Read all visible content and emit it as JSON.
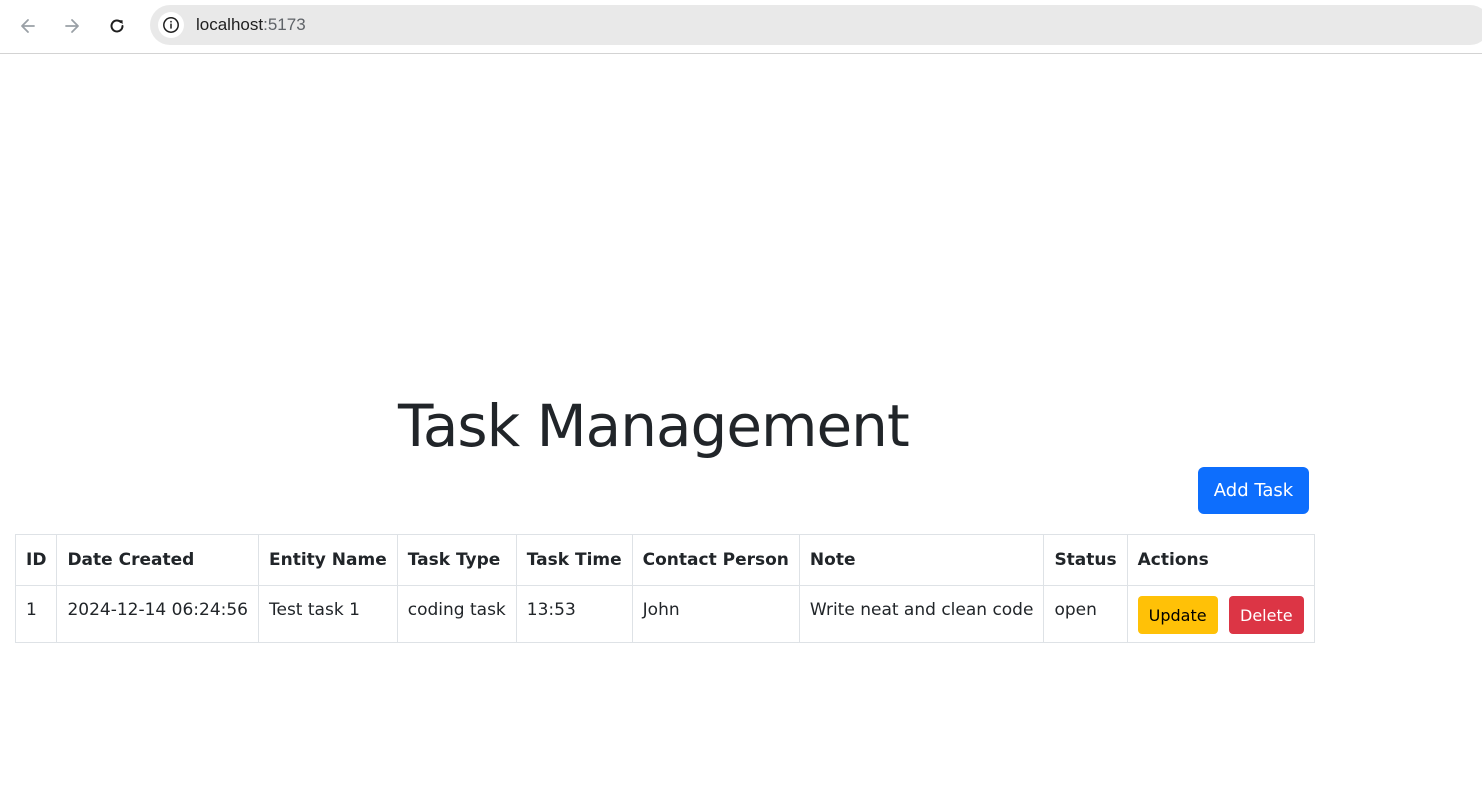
{
  "browser": {
    "url_host": "localhost",
    "url_port": ":5173"
  },
  "page": {
    "title": "Task Management",
    "add_button_label": "Add Task"
  },
  "table": {
    "columns": [
      "ID",
      "Date Created",
      "Entity Name",
      "Task Type",
      "Task Time",
      "Contact Person",
      "Note",
      "Status",
      "Actions"
    ],
    "rows": [
      {
        "id": "1",
        "date_created": "2024-12-14 06:24:56",
        "entity_name": "Test task 1",
        "task_type": "coding task",
        "task_time": "13:53",
        "contact_person": "John",
        "note": "Write neat and clean code",
        "status": "open",
        "update_label": "Update",
        "delete_label": "Delete"
      }
    ]
  },
  "colors": {
    "primary": "#0d6efd",
    "warning": "#ffc107",
    "danger": "#dc3545"
  },
  "icons": [
    "back-arrow-icon",
    "forward-arrow-icon",
    "reload-icon",
    "info-icon"
  ]
}
